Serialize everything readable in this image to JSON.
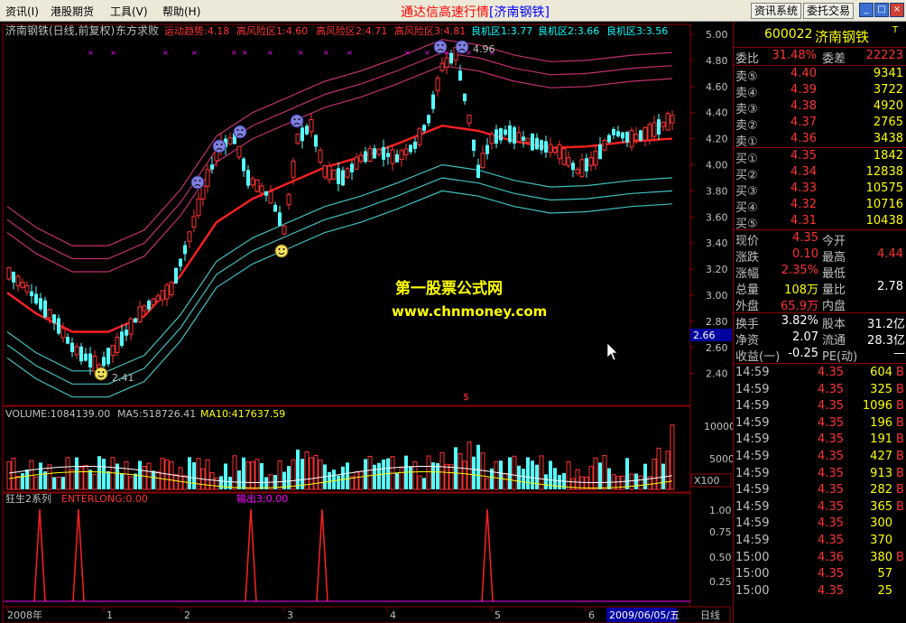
{
  "menu": {
    "items": [
      "资讯(I)",
      "港股期货",
      "工具(V)",
      "帮助(H)"
    ],
    "title": "通达信高速行情",
    "title_stock": "[济南钢铁]",
    "btn_info": "资讯系统",
    "btn_trade": "委托交易"
  },
  "chart_header": {
    "stock_label": "济南钢铁(日线,前复权)",
    "strategy": "东方求败",
    "indicators": [
      {
        "text": "运动趋势:4.18",
        "color": "#ff3232"
      },
      {
        "text": "高风险区1:4.60",
        "color": "#ff3232"
      },
      {
        "text": "高风险区2:4.71",
        "color": "#ff3232"
      },
      {
        "text": "高风险区3:4.81",
        "color": "#ff3232"
      },
      {
        "text": "良机区1:3.77",
        "color": "#00ffff"
      },
      {
        "text": "良机区2:3.66",
        "color": "#00ffff"
      },
      {
        "text": "良机区3:3.56",
        "color": "#00ffff"
      }
    ]
  },
  "watermark": {
    "line1": "第一股票公式网",
    "line2": "www.chnmoney.com"
  },
  "price_axis": {
    "labels": [
      "5.00",
      "4.80",
      "4.60",
      "4.40",
      "4.20",
      "4.00",
      "3.80",
      "3.60",
      "3.40",
      "3.20",
      "3.00",
      "2.80",
      "2.60",
      "2.40"
    ],
    "current": "2.66",
    "high_label": "4.96",
    "low_label": "2.41"
  },
  "volume_panel": {
    "header_vol": "VOLUME:1084139.00",
    "header_ma5": "MA5:518726.41",
    "header_ma10": "MA10:417637.59",
    "axis": [
      "10000",
      "5000",
      "X100"
    ]
  },
  "indicator_panel": {
    "name": "狂生2系列",
    "enterlong": "ENTERLONG:0.00",
    "output": "输出3:0.00",
    "axis": [
      "1.00",
      "0.75",
      "0.50",
      "0.25"
    ]
  },
  "time_axis": {
    "labels": [
      "2008年",
      "1",
      "2",
      "3",
      "4",
      "5",
      "6"
    ],
    "current_date": "2009/06/05/五",
    "period": "日线"
  },
  "quote": {
    "code": "600022",
    "name": "济南钢铁",
    "weibi_label": "委比",
    "weibi_val": "31.48%",
    "weicha_label": "委差",
    "weicha_val": "22223",
    "asks": [
      {
        "label": "卖⑤",
        "price": "4.40",
        "vol": "9341"
      },
      {
        "label": "卖④",
        "price": "4.39",
        "vol": "3722"
      },
      {
        "label": "卖③",
        "price": "4.38",
        "vol": "4920"
      },
      {
        "label": "卖②",
        "price": "4.37",
        "vol": "2765"
      },
      {
        "label": "卖①",
        "price": "4.36",
        "vol": "3438"
      }
    ],
    "bids": [
      {
        "label": "买①",
        "price": "4.35",
        "vol": "1842"
      },
      {
        "label": "买②",
        "price": "4.34",
        "vol": "12838"
      },
      {
        "label": "买③",
        "price": "4.33",
        "vol": "10575"
      },
      {
        "label": "买④",
        "price": "4.32",
        "vol": "10716"
      },
      {
        "label": "买⑤",
        "price": "4.31",
        "vol": "10438"
      }
    ],
    "stats": [
      {
        "l1": "现价",
        "v1": "4.35",
        "c1": "red",
        "l2": "今开",
        "v2": "",
        "c2": "red"
      },
      {
        "l1": "涨跌",
        "v1": "0.10",
        "c1": "red",
        "l2": "最高",
        "v2": "4.44",
        "c2": "red"
      },
      {
        "l1": "涨幅",
        "v1": "2.35%",
        "c1": "red",
        "l2": "最低",
        "v2": "",
        "c2": "red"
      },
      {
        "l1": "总量",
        "v1": "108万",
        "c1": "yellow",
        "l2": "量比",
        "v2": "2.78",
        "c2": "white"
      },
      {
        "l1": "外盘",
        "v1": "65.9万",
        "c1": "red",
        "l2": "内盘",
        "v2": "",
        "c2": "green"
      }
    ],
    "stats2": [
      {
        "l1": "换手",
        "v1": "3.82%",
        "l2": "股本",
        "v2": "31.2亿"
      },
      {
        "l1": "净资",
        "v1": "2.07",
        "l2": "流通",
        "v2": "28.3亿"
      },
      {
        "l1": "收益(一)",
        "v1": "-0.25",
        "l2": "PE(动)",
        "v2": "—"
      }
    ],
    "ticks": [
      {
        "time": "14:59",
        "price": "4.35",
        "vol": "604",
        "bs": "B"
      },
      {
        "time": "14:59",
        "price": "4.35",
        "vol": "325",
        "bs": "B"
      },
      {
        "time": "14:59",
        "price": "4.35",
        "vol": "1096",
        "bs": "B"
      },
      {
        "time": "14:59",
        "price": "4.35",
        "vol": "196",
        "bs": "B"
      },
      {
        "time": "14:59",
        "price": "4.35",
        "vol": "191",
        "bs": "B"
      },
      {
        "time": "14:59",
        "price": "4.35",
        "vol": "427",
        "bs": "B"
      },
      {
        "time": "14:59",
        "price": "4.35",
        "vol": "913",
        "bs": "B"
      },
      {
        "time": "14:59",
        "price": "4.35",
        "vol": "282",
        "bs": "B"
      },
      {
        "time": "14:59",
        "price": "4.35",
        "vol": "365",
        "bs": "B"
      },
      {
        "time": "14:59",
        "price": "4.35",
        "vol": "300",
        "bs": ""
      },
      {
        "time": "14:59",
        "price": "4.35",
        "vol": "370",
        "bs": ""
      },
      {
        "time": "15:00",
        "price": "4.36",
        "vol": "380",
        "bs": "B"
      },
      {
        "time": "15:00",
        "price": "4.35",
        "vol": "57",
        "bs": ""
      },
      {
        "time": "15:00",
        "price": "4.35",
        "vol": "25",
        "bs": ""
      }
    ]
  }
}
